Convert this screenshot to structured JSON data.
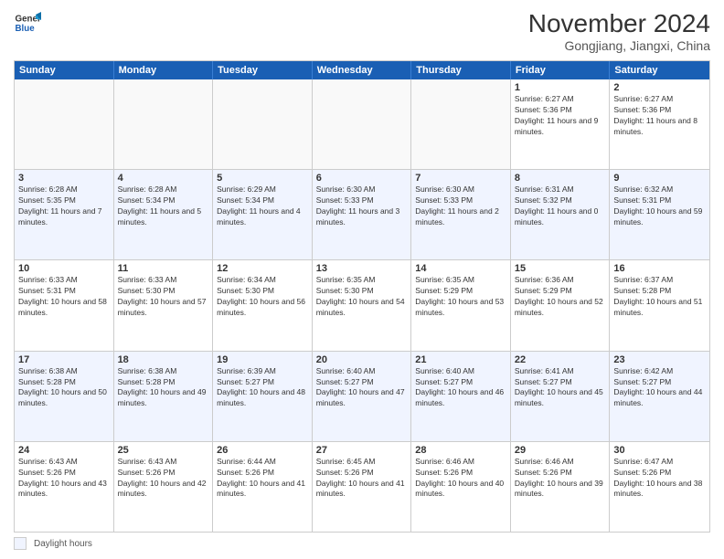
{
  "logo": {
    "line1": "General",
    "line2": "Blue"
  },
  "title": "November 2024",
  "subtitle": "Gongjiang, Jiangxi, China",
  "days_of_week": [
    "Sunday",
    "Monday",
    "Tuesday",
    "Wednesday",
    "Thursday",
    "Friday",
    "Saturday"
  ],
  "legend_label": "Daylight hours",
  "weeks": [
    [
      {
        "day": "",
        "info": "",
        "empty": true
      },
      {
        "day": "",
        "info": "",
        "empty": true
      },
      {
        "day": "",
        "info": "",
        "empty": true
      },
      {
        "day": "",
        "info": "",
        "empty": true
      },
      {
        "day": "",
        "info": "",
        "empty": true
      },
      {
        "day": "1",
        "info": "Sunrise: 6:27 AM\nSunset: 5:36 PM\nDaylight: 11 hours and 9 minutes.",
        "empty": false
      },
      {
        "day": "2",
        "info": "Sunrise: 6:27 AM\nSunset: 5:36 PM\nDaylight: 11 hours and 8 minutes.",
        "empty": false
      }
    ],
    [
      {
        "day": "3",
        "info": "Sunrise: 6:28 AM\nSunset: 5:35 PM\nDaylight: 11 hours and 7 minutes.",
        "empty": false
      },
      {
        "day": "4",
        "info": "Sunrise: 6:28 AM\nSunset: 5:34 PM\nDaylight: 11 hours and 5 minutes.",
        "empty": false
      },
      {
        "day": "5",
        "info": "Sunrise: 6:29 AM\nSunset: 5:34 PM\nDaylight: 11 hours and 4 minutes.",
        "empty": false
      },
      {
        "day": "6",
        "info": "Sunrise: 6:30 AM\nSunset: 5:33 PM\nDaylight: 11 hours and 3 minutes.",
        "empty": false
      },
      {
        "day": "7",
        "info": "Sunrise: 6:30 AM\nSunset: 5:33 PM\nDaylight: 11 hours and 2 minutes.",
        "empty": false
      },
      {
        "day": "8",
        "info": "Sunrise: 6:31 AM\nSunset: 5:32 PM\nDaylight: 11 hours and 0 minutes.",
        "empty": false
      },
      {
        "day": "9",
        "info": "Sunrise: 6:32 AM\nSunset: 5:31 PM\nDaylight: 10 hours and 59 minutes.",
        "empty": false
      }
    ],
    [
      {
        "day": "10",
        "info": "Sunrise: 6:33 AM\nSunset: 5:31 PM\nDaylight: 10 hours and 58 minutes.",
        "empty": false
      },
      {
        "day": "11",
        "info": "Sunrise: 6:33 AM\nSunset: 5:30 PM\nDaylight: 10 hours and 57 minutes.",
        "empty": false
      },
      {
        "day": "12",
        "info": "Sunrise: 6:34 AM\nSunset: 5:30 PM\nDaylight: 10 hours and 56 minutes.",
        "empty": false
      },
      {
        "day": "13",
        "info": "Sunrise: 6:35 AM\nSunset: 5:30 PM\nDaylight: 10 hours and 54 minutes.",
        "empty": false
      },
      {
        "day": "14",
        "info": "Sunrise: 6:35 AM\nSunset: 5:29 PM\nDaylight: 10 hours and 53 minutes.",
        "empty": false
      },
      {
        "day": "15",
        "info": "Sunrise: 6:36 AM\nSunset: 5:29 PM\nDaylight: 10 hours and 52 minutes.",
        "empty": false
      },
      {
        "day": "16",
        "info": "Sunrise: 6:37 AM\nSunset: 5:28 PM\nDaylight: 10 hours and 51 minutes.",
        "empty": false
      }
    ],
    [
      {
        "day": "17",
        "info": "Sunrise: 6:38 AM\nSunset: 5:28 PM\nDaylight: 10 hours and 50 minutes.",
        "empty": false
      },
      {
        "day": "18",
        "info": "Sunrise: 6:38 AM\nSunset: 5:28 PM\nDaylight: 10 hours and 49 minutes.",
        "empty": false
      },
      {
        "day": "19",
        "info": "Sunrise: 6:39 AM\nSunset: 5:27 PM\nDaylight: 10 hours and 48 minutes.",
        "empty": false
      },
      {
        "day": "20",
        "info": "Sunrise: 6:40 AM\nSunset: 5:27 PM\nDaylight: 10 hours and 47 minutes.",
        "empty": false
      },
      {
        "day": "21",
        "info": "Sunrise: 6:40 AM\nSunset: 5:27 PM\nDaylight: 10 hours and 46 minutes.",
        "empty": false
      },
      {
        "day": "22",
        "info": "Sunrise: 6:41 AM\nSunset: 5:27 PM\nDaylight: 10 hours and 45 minutes.",
        "empty": false
      },
      {
        "day": "23",
        "info": "Sunrise: 6:42 AM\nSunset: 5:27 PM\nDaylight: 10 hours and 44 minutes.",
        "empty": false
      }
    ],
    [
      {
        "day": "24",
        "info": "Sunrise: 6:43 AM\nSunset: 5:26 PM\nDaylight: 10 hours and 43 minutes.",
        "empty": false
      },
      {
        "day": "25",
        "info": "Sunrise: 6:43 AM\nSunset: 5:26 PM\nDaylight: 10 hours and 42 minutes.",
        "empty": false
      },
      {
        "day": "26",
        "info": "Sunrise: 6:44 AM\nSunset: 5:26 PM\nDaylight: 10 hours and 41 minutes.",
        "empty": false
      },
      {
        "day": "27",
        "info": "Sunrise: 6:45 AM\nSunset: 5:26 PM\nDaylight: 10 hours and 41 minutes.",
        "empty": false
      },
      {
        "day": "28",
        "info": "Sunrise: 6:46 AM\nSunset: 5:26 PM\nDaylight: 10 hours and 40 minutes.",
        "empty": false
      },
      {
        "day": "29",
        "info": "Sunrise: 6:46 AM\nSunset: 5:26 PM\nDaylight: 10 hours and 39 minutes.",
        "empty": false
      },
      {
        "day": "30",
        "info": "Sunrise: 6:47 AM\nSunset: 5:26 PM\nDaylight: 10 hours and 38 minutes.",
        "empty": false
      }
    ]
  ]
}
